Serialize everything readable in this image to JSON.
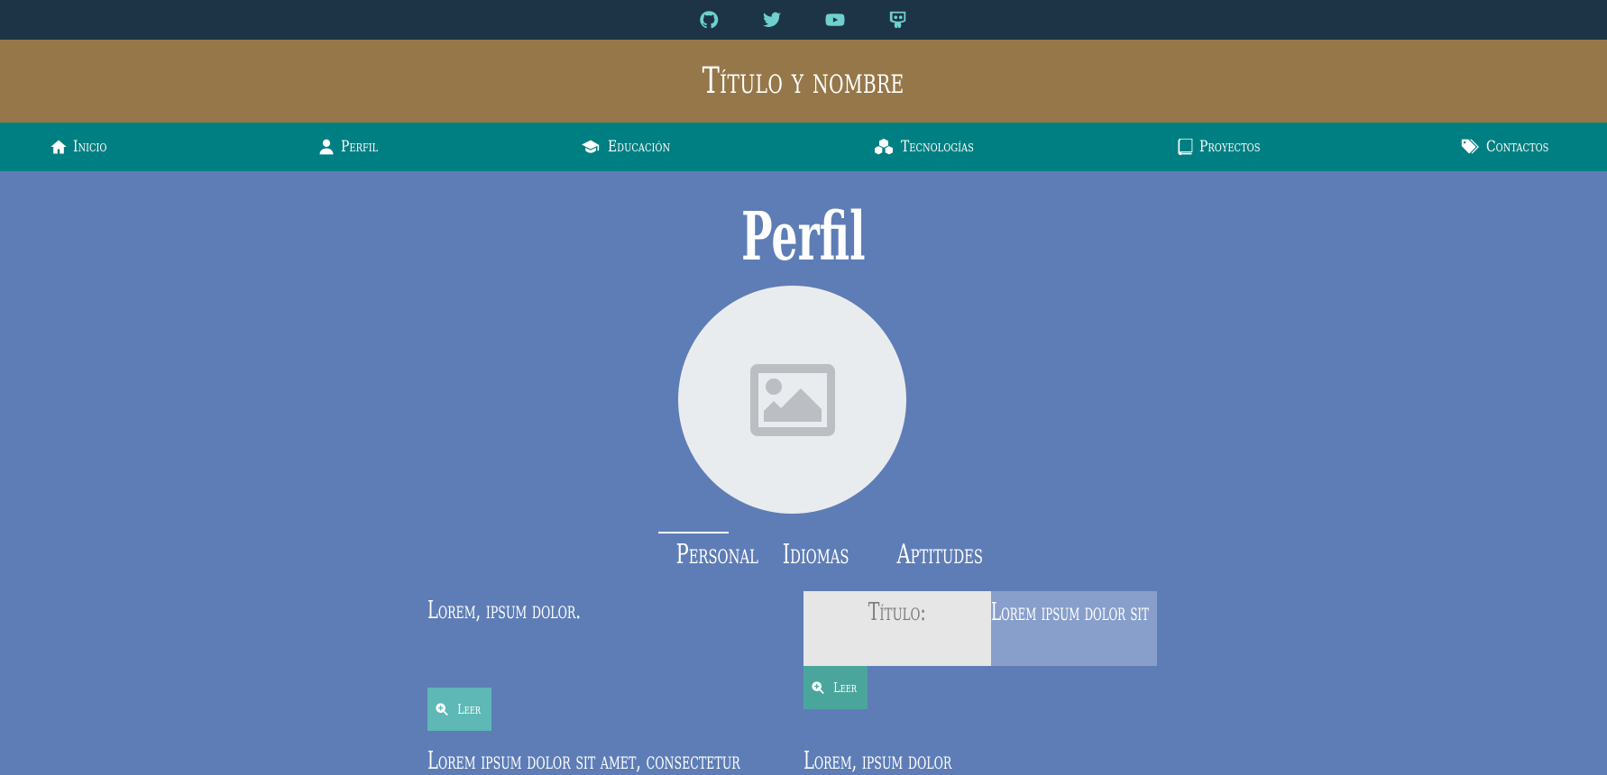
{
  "social": {
    "items": [
      {
        "name": "github-icon",
        "color": "#6fd0ce"
      },
      {
        "name": "twitter-icon",
        "color": "#6fd0ce"
      },
      {
        "name": "youtube-icon",
        "color": "#6fd0ce"
      },
      {
        "name": "slideshare-icon",
        "color": "#6fd0ce"
      }
    ]
  },
  "header": {
    "title": "Título y nombre"
  },
  "nav": {
    "items": [
      {
        "label": "Inicio",
        "icon": "home-icon"
      },
      {
        "label": "Perfil",
        "icon": "user-icon"
      },
      {
        "label": "Educación",
        "icon": "graduation-cap-icon"
      },
      {
        "label": "Tecnologías",
        "icon": "cubes-icon"
      },
      {
        "label": "Proyectos",
        "icon": "book-icon"
      },
      {
        "label": "Contactos",
        "icon": "tags-icon"
      }
    ]
  },
  "main": {
    "heading": "Perfil",
    "avatar_icon": "image-placeholder-icon",
    "tabs": [
      {
        "label": "Personal",
        "active": true
      },
      {
        "label": "Idiomas",
        "active": false
      },
      {
        "label": "Aptitudes",
        "active": false
      }
    ],
    "left_card": {
      "title": "Lorem, ipsum dolor.",
      "button_label": "Leer"
    },
    "info": {
      "key": "Título:",
      "value": "Lorem ipsum dolor sit",
      "button_label": "Leer"
    },
    "bottom_left_title": "Lorem ipsum dolor sit amet, consectetur",
    "bottom_right_title": "Lorem, ipsum dolor"
  },
  "colors": {
    "background": "#5e7db6",
    "social_bar": "#1d3446",
    "title_bar": "#967749",
    "nav_bar": "#007f82",
    "button": "#5db8b6",
    "info_key_bg": "#e6e6e6",
    "info_value_bg": "#889fcc"
  }
}
